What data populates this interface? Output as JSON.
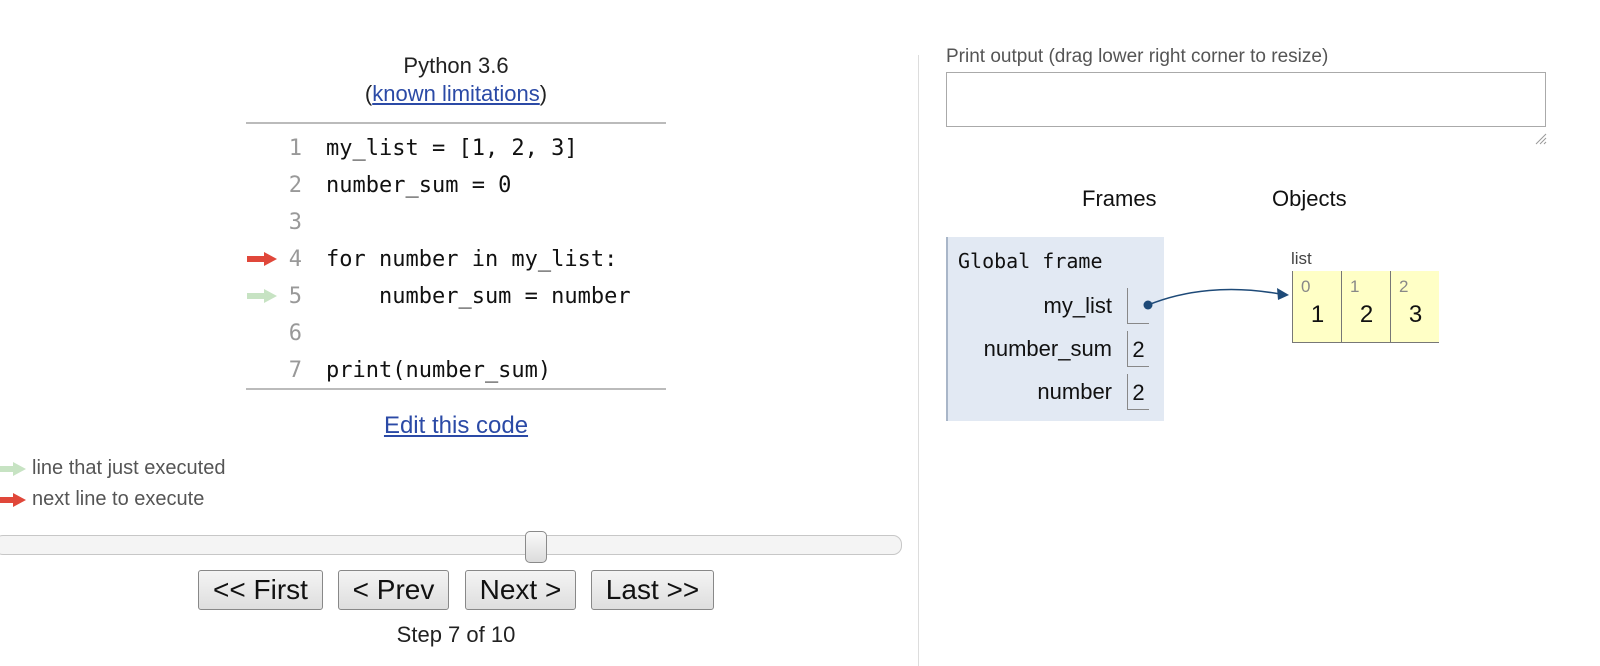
{
  "header": {
    "language": "Python 3.6",
    "paren_open": "(",
    "limitations_link": "known limitations",
    "paren_close": ")"
  },
  "code": {
    "lines": [
      {
        "num": "1",
        "text": "my_list = [1, 2, 3]"
      },
      {
        "num": "2",
        "text": "number_sum = 0"
      },
      {
        "num": "3",
        "text": ""
      },
      {
        "num": "4",
        "text": "for number in my_list:"
      },
      {
        "num": "5",
        "text": "    number_sum = number"
      },
      {
        "num": "6",
        "text": ""
      },
      {
        "num": "7",
        "text": "print(number_sum)"
      }
    ],
    "next_line": "4",
    "just_executed_line": "5"
  },
  "edit_link": "Edit this code",
  "legend": {
    "just_executed": "line that just executed",
    "next_line": "next line to execute"
  },
  "controls": {
    "first": "<< First",
    "prev": "< Prev",
    "next": "Next >",
    "last": "Last >>",
    "step_label": "Step 7 of 10",
    "step": 7,
    "total_steps": 10
  },
  "print_output": {
    "label": "Print output (drag lower right corner to resize)",
    "value": ""
  },
  "viz": {
    "frames_header": "Frames",
    "objects_header": "Objects",
    "global_frame": {
      "title": "Global frame",
      "vars": [
        {
          "name": "my_list",
          "value": ""
        },
        {
          "name": "number_sum",
          "value": "2"
        },
        {
          "name": "number",
          "value": "2"
        }
      ]
    },
    "list_object": {
      "type_label": "list",
      "items": [
        {
          "index": "0",
          "value": "1"
        },
        {
          "index": "1",
          "value": "2"
        },
        {
          "index": "2",
          "value": "3"
        }
      ]
    }
  },
  "colors": {
    "next_arrow": "#e0473a",
    "executed_arrow": "#c7e3c3",
    "link": "#2b4aa6",
    "frame_bg": "#e2e9f3",
    "object_bg": "#ffffc6",
    "pointer": "#1e4a78"
  }
}
